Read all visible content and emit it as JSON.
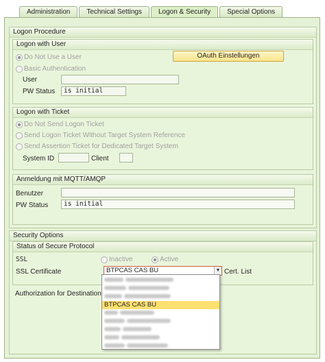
{
  "tabs": [
    "Administration",
    "Technical Settings",
    "Logon & Security",
    "Special Options"
  ],
  "active_tab": 2,
  "logon_procedure": {
    "title": "Logon Procedure",
    "logon_with_user": {
      "title": "Logon with User",
      "radio_do_not_use": "Do Not Use a User",
      "radio_basic": "Basic Authentication",
      "oauth_button": "OAuth Einstellungen",
      "user_label": "User",
      "user_value": "",
      "pw_status_label": "PW Status",
      "pw_status_value": "is initial"
    },
    "logon_with_ticket": {
      "title": "Logon with Ticket",
      "radio_do_not_send": "Do Not Send Logon Ticket",
      "radio_send_without_ref": "Send Logon Ticket Without Target System Reference",
      "radio_send_assertion": "Send Assertion Ticket for Dedicated Target System",
      "system_id_label": "System ID",
      "client_label": "Client"
    },
    "mqtt": {
      "title": "Anmeldung mit MQTT/AMQP",
      "benutzer_label": "Benutzer",
      "benutzer_value": "",
      "pw_status_label": "PW Status",
      "pw_status_value": "is initial"
    }
  },
  "security_options": {
    "title": "Security Options",
    "status_secure_protocol": "Status of Secure Protocol",
    "ssl_label": "SSL",
    "radio_inactive": "Inactive",
    "radio_active": "Active",
    "ssl_certificate_label": "SSL Certificate",
    "ssl_certificate_value": "BTPCAS CAS BU",
    "cert_list": "Cert. List",
    "authorization_label": "Authorization for Destination",
    "dropdown_highlighted": "BTPCAS  CAS BU"
  },
  "colors": {
    "panel_bg": "#e5f2d6",
    "highlight": "#ffe071",
    "button_bg": "#fbe489"
  }
}
